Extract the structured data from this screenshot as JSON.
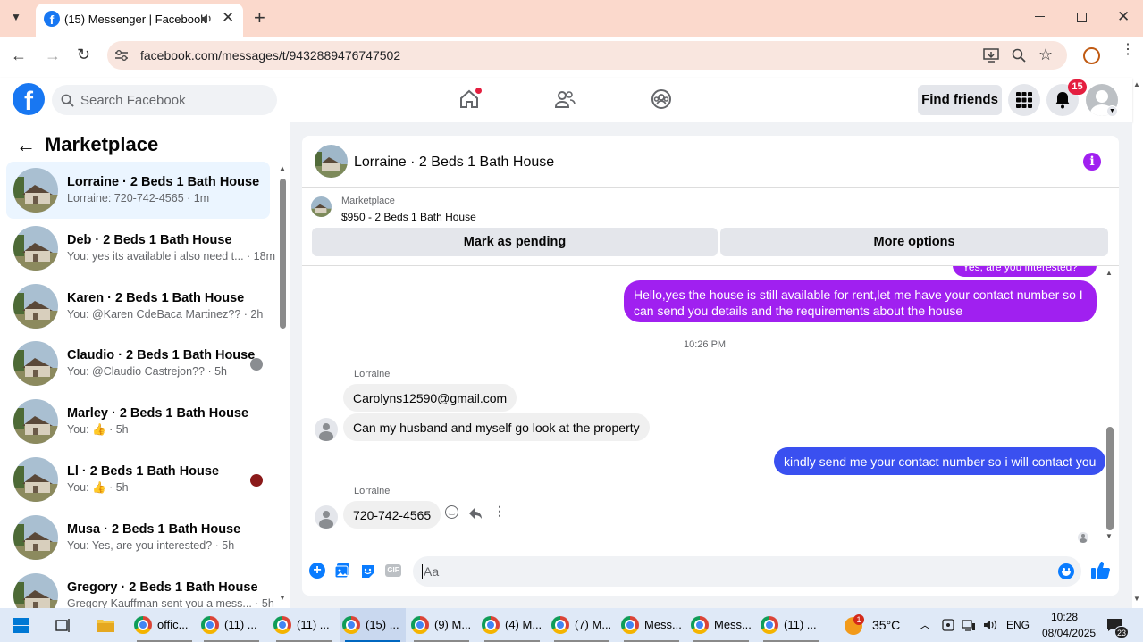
{
  "browser": {
    "tab_title": "(15) Messenger | Facebook",
    "url": "facebook.com/messages/t/9432889476747502"
  },
  "fb": {
    "search_placeholder": "Search Facebook",
    "find_friends": "Find friends",
    "notification_count": "15"
  },
  "sidebar": {
    "title": "Marketplace",
    "conversations": [
      {
        "title": "Lorraine · 2 Beds 1 Bath House",
        "preview": "Lorraine: 720-742-4565 · 1m"
      },
      {
        "title": "Deb · 2 Beds 1 Bath House",
        "preview": "You: yes its available i also need t... · 18m"
      },
      {
        "title": "Karen · 2 Beds 1 Bath House",
        "preview": "You: @Karen CdeBaca Martinez?? · 2h"
      },
      {
        "title": "Claudio · 2 Beds 1 Bath House",
        "preview": "You: @Claudio Castrejon?? · 5h"
      },
      {
        "title": "Marley · 2 Beds 1 Bath House",
        "preview": "You: 👍 · 5h"
      },
      {
        "title": "Ll · 2 Beds 1 Bath House",
        "preview": "You: 👍 · 5h"
      },
      {
        "title": "Musa · 2 Beds 1 Bath House",
        "preview": "You: Yes, are you interested? · 5h"
      },
      {
        "title": "Gregory · 2 Beds 1 Bath House",
        "preview": "Gregory Kauffman sent you a mess... · 5h"
      }
    ]
  },
  "chat": {
    "title": "Lorraine · 2 Beds 1 Bath House",
    "listing_label": "Marketplace",
    "listing_price": "$950 - 2 Beds 1 Bath House",
    "mark_pending": "Mark as pending",
    "more_options": "More options",
    "partial_message": "Yes, are you interested?",
    "msg_out_1_line1": "Hello,yes the house is still available for rent,let me have your contact number  so I",
    "msg_out_1_line2": "can send you details and the requirements about the house",
    "timestamp": "10:26 PM",
    "sender_1": "Lorraine",
    "msg_in_1": "Carolyns12590@gmail.com",
    "msg_in_2": "Can my husband and myself go look at the property",
    "msg_out_2": "kindly send me your contact number so i will contact you",
    "sender_2": "Lorraine",
    "msg_in_3": "720-742-4565",
    "composer_placeholder": "Aa"
  },
  "taskbar": {
    "items": [
      "offic...",
      "(11) ...",
      "(11) ...",
      "(15) ...",
      "(9) M...",
      "(4) M...",
      "(7) M...",
      "Mess...",
      "Mess...",
      "(11) ..."
    ],
    "weather_badge": "1",
    "temperature": "35°C",
    "language": "ENG",
    "time": "10:28",
    "date": "08/04/2025",
    "notif_count": "23"
  }
}
